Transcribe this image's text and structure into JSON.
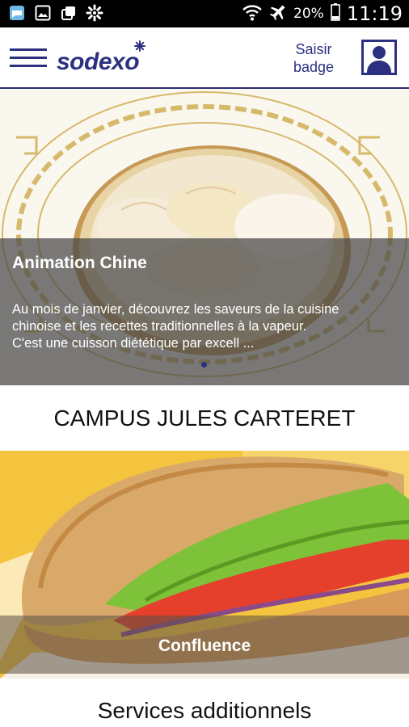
{
  "status_bar": {
    "battery_percent": "20%",
    "time": "11:19",
    "left_icons": [
      "messages-icon",
      "gallery-icon",
      "copy-icon",
      "settings-icon"
    ],
    "right_icons": [
      "wifi-icon",
      "airplane-icon",
      "battery-icon"
    ]
  },
  "app_bar": {
    "logo_text": "sodexo",
    "badge_button_line1": "Saisir",
    "badge_button_line2": "badge",
    "brand_color": "#2b3080"
  },
  "banner": {
    "title": "Animation Chine",
    "text_line1": "Au mois de janvier, découvrez les saveurs de la cuisine",
    "text_line2": "chinoise et les recettes traditionnelles à la vapeur.",
    "text_line3": "C'est une cuisson diététique par excell ..."
  },
  "campus": {
    "title": "CAMPUS JULES CARTERET"
  },
  "restaurant_card": {
    "label": "Confluence"
  },
  "services": {
    "title": "Services additionnels"
  }
}
